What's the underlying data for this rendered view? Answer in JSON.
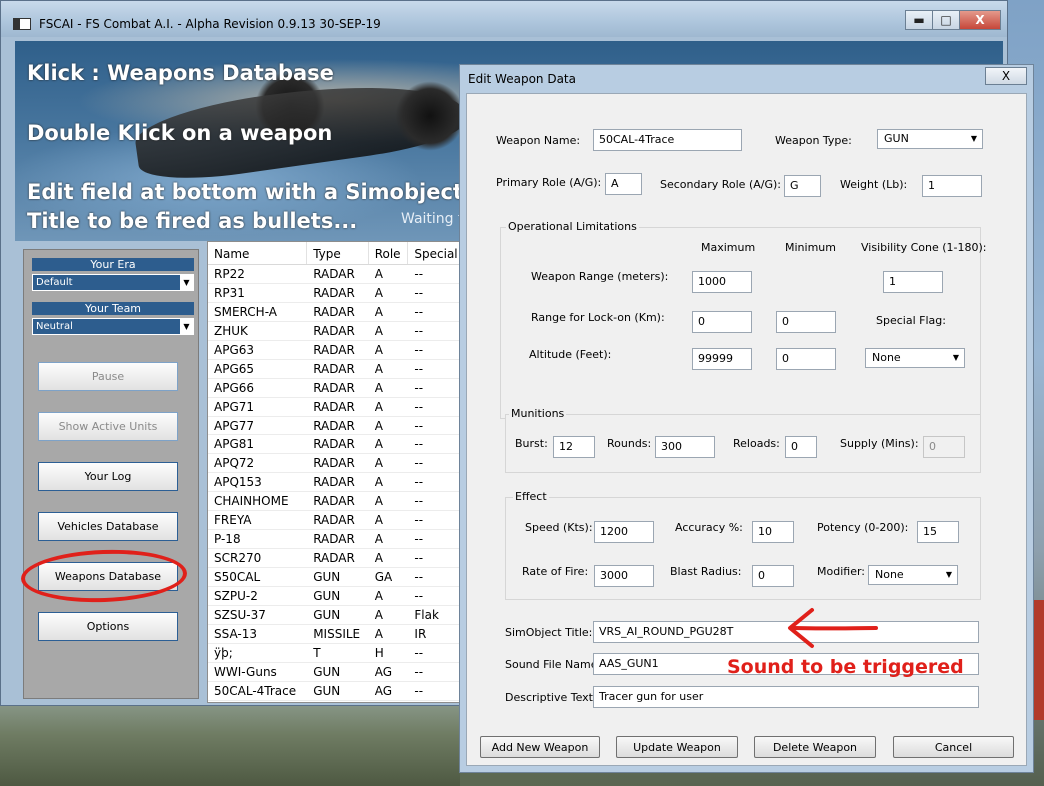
{
  "window": {
    "title": "FSCAI - FS Combat A.I. - Alpha Revision 0.9.13 30-SEP-19",
    "min_glyph": "▬",
    "max_glyph": "□",
    "close_glyph": "X"
  },
  "banner": {
    "line1": "Klick : Weapons Database",
    "line2": "Double Klick on a weapon",
    "line3": "Edit field at bottom with a Simobject",
    "line4": "Title to be fired as bullets...",
    "status": "Waiting fo"
  },
  "side_panel": {
    "era_label": "Your Era",
    "era_value": "Default",
    "team_label": "Your Team",
    "team_value": "Neutral",
    "pause": "Pause",
    "show_active_units": "Show Active Units",
    "your_log": "Your Log",
    "vehicles_database": "Vehicles Database",
    "weapons_database": "Weapons Database",
    "options": "Options"
  },
  "weapon_list": {
    "headers": [
      "Name",
      "Type",
      "Role",
      "Special"
    ],
    "rows": [
      [
        "RP22",
        "RADAR",
        "A",
        "--"
      ],
      [
        "RP31",
        "RADAR",
        "A",
        "--"
      ],
      [
        "SMERCH-A",
        "RADAR",
        "A",
        "--"
      ],
      [
        "ZHUK",
        "RADAR",
        "A",
        "--"
      ],
      [
        "APG63",
        "RADAR",
        "A",
        "--"
      ],
      [
        "APG65",
        "RADAR",
        "A",
        "--"
      ],
      [
        "APG66",
        "RADAR",
        "A",
        "--"
      ],
      [
        "APG71",
        "RADAR",
        "A",
        "--"
      ],
      [
        "APG77",
        "RADAR",
        "A",
        "--"
      ],
      [
        "APG81",
        "RADAR",
        "A",
        "--"
      ],
      [
        "APQ72",
        "RADAR",
        "A",
        "--"
      ],
      [
        "APQ153",
        "RADAR",
        "A",
        "--"
      ],
      [
        "CHAINHOME",
        "RADAR",
        "A",
        "--"
      ],
      [
        "FREYA",
        "RADAR",
        "A",
        "--"
      ],
      [
        "P-18",
        "RADAR",
        "A",
        "--"
      ],
      [
        "SCR270",
        "RADAR",
        "A",
        "--"
      ],
      [
        "S50CAL",
        "GUN",
        "GA",
        "--"
      ],
      [
        "SZPU-2",
        "GUN",
        "A",
        "--"
      ],
      [
        "SZSU-37",
        "GUN",
        "A",
        "Flak"
      ],
      [
        "SSA-13",
        "MISSILE",
        "A",
        "IR"
      ],
      [
        "ÿþ;",
        "T",
        "H",
        "--"
      ],
      [
        "WWI-Guns",
        "GUN",
        "AG",
        "--"
      ],
      [
        "50CAL-4Trace",
        "GUN",
        "AG",
        "--"
      ]
    ]
  },
  "dialog": {
    "title": "Edit Weapon Data",
    "close_glyph": "X",
    "weapon_name_label": "Weapon Name:",
    "weapon_name": "50CAL-4Trace",
    "weapon_type_label": "Weapon Type:",
    "weapon_type": "GUN",
    "primary_role_label": "Primary Role (A/G):",
    "primary_role": "A",
    "secondary_role_label": "Secondary Role (A/G):",
    "secondary_role": "G",
    "weight_label": "Weight (Lb):",
    "weight": "1",
    "ops": {
      "caption": "Operational Limitations",
      "maximum": "Maximum",
      "minimum": "Minimum",
      "visibility_cone": "Visibility Cone (1-180):",
      "weapon_range_label": "Weapon Range (meters):",
      "weapon_range_max": "1000",
      "visibility_cone_value": "1",
      "lockon_label": "Range for Lock-on (Km):",
      "lockon_max": "0",
      "lockon_min": "0",
      "special_flag_label": "Special Flag:",
      "altitude_label": "Altitude (Feet):",
      "altitude_max": "99999",
      "altitude_min": "0",
      "special_flag": "None"
    },
    "munitions": {
      "caption": "Munitions",
      "burst_label": "Burst:",
      "burst": "12",
      "rounds_label": "Rounds:",
      "rounds": "300",
      "reloads_label": "Reloads:",
      "reloads": "0",
      "supply_label": "Supply (Mins):",
      "supply": "0"
    },
    "effect": {
      "caption": "Effect",
      "speed_label": "Speed (Kts):",
      "speed": "1200",
      "accuracy_label": "Accuracy %:",
      "accuracy": "10",
      "potency_label": "Potency (0-200):",
      "potency": "15",
      "rate_label": "Rate of Fire:",
      "rate": "3000",
      "blast_label": "Blast Radius:",
      "blast": "0",
      "modifier_label": "Modifier:",
      "modifier": "None"
    },
    "simobject_label": "SimObject Title:",
    "simobject": "VRS_AI_ROUND_PGU28T",
    "sound_label": "Sound File Name:",
    "sound": "AAS_GUN1",
    "desc_label": "Descriptive Text:",
    "desc": "Tracer gun for user",
    "buttons": {
      "add": "Add New Weapon",
      "update": "Update Weapon",
      "delete": "Delete Weapon",
      "cancel": "Cancel"
    }
  },
  "annotation": {
    "sound_note": "Sound to be triggered",
    "color": "#e0201a"
  },
  "icons": {
    "dropdown_arrow": "▼"
  }
}
